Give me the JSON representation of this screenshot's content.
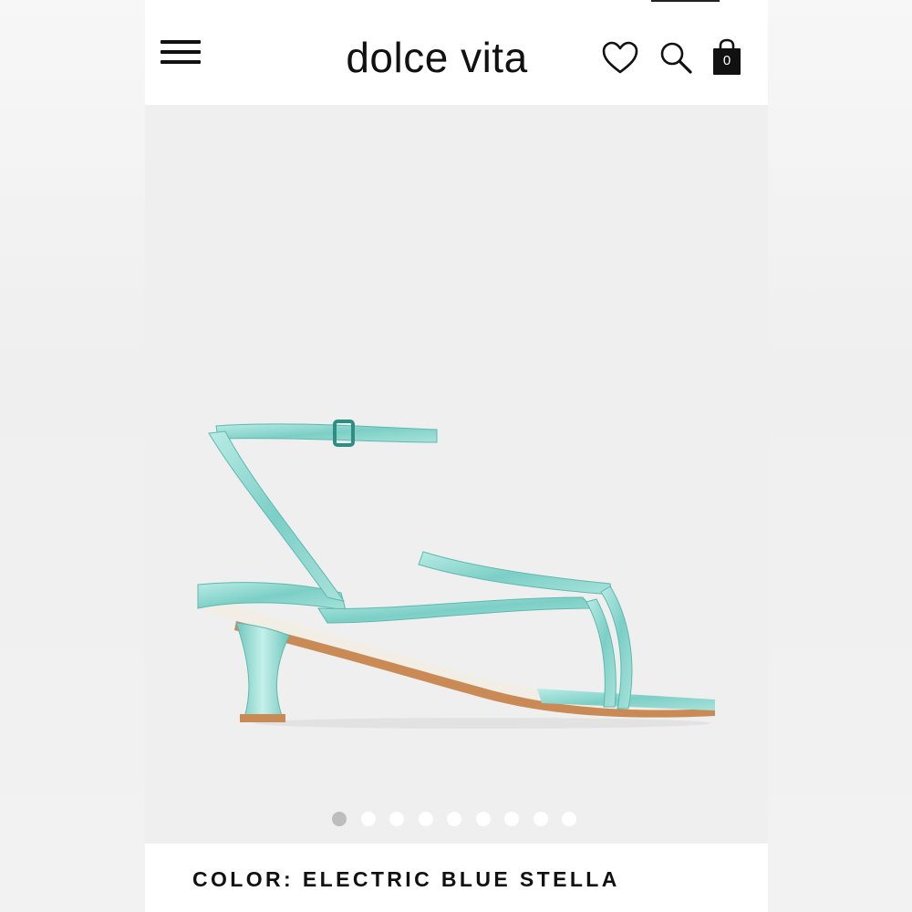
{
  "header": {
    "brand": "dolce vita",
    "cart_count": "0"
  },
  "icons": {
    "menu": "hamburger-menu-icon",
    "wishlist": "heart-icon",
    "search": "search-icon",
    "cart": "shopping-bag-icon"
  },
  "gallery": {
    "total_images": 9,
    "active_index": 0
  },
  "product": {
    "color_label": "COLOR: ELECTRIC BLUE STELLA"
  },
  "colors": {
    "accent": "#111111",
    "strap": "#8fd6cf",
    "heel_sole": "#c98a55"
  }
}
